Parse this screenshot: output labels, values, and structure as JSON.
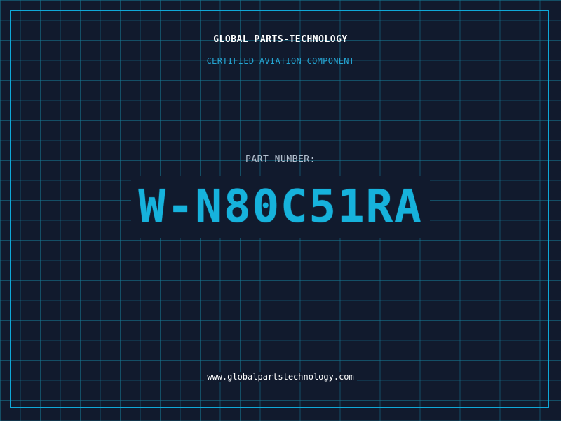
{
  "header": {
    "company": "GLOBAL PARTS-TECHNOLOGY",
    "tagline": "CERTIFIED AVIATION COMPONENT"
  },
  "part": {
    "label": "PART NUMBER:",
    "number": "W-N80C51RA"
  },
  "footer": {
    "website": "www.globalpartstechnology.com"
  },
  "colors": {
    "background": "#111a2d",
    "grid": "#157a96",
    "accent": "#16b2dc",
    "frame": "#0fa8d8",
    "text": "#ffffff",
    "label": "#b6c2d1"
  }
}
